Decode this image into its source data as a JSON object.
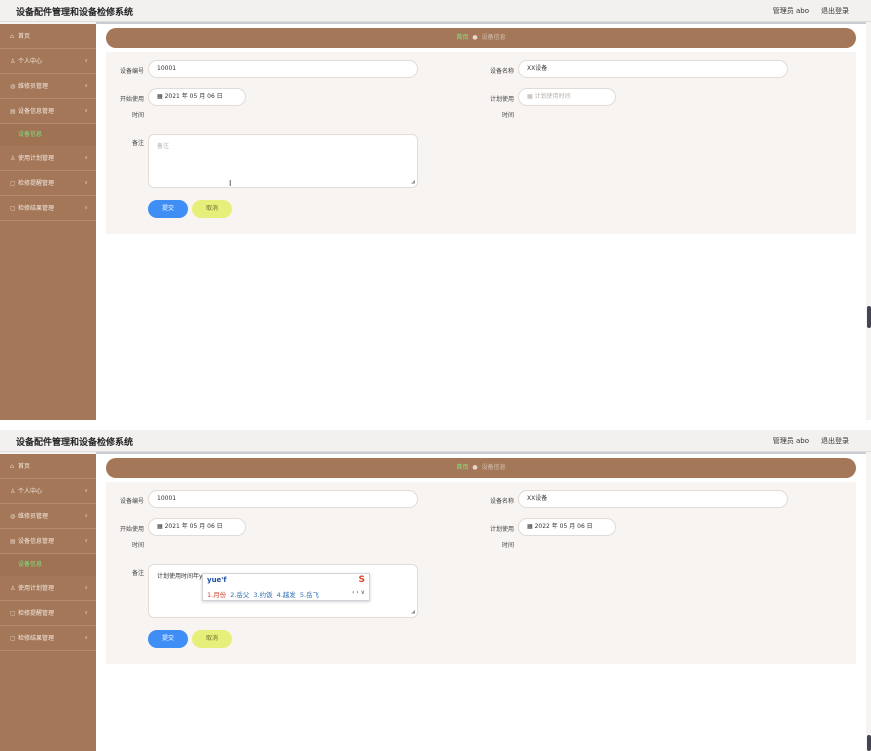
{
  "app": {
    "title": "设备配件管理和设备检修系统",
    "admin": "管理员 abo",
    "logout": "退出登录"
  },
  "sidebar": {
    "items": [
      {
        "icon": "⌂",
        "label": "首页"
      },
      {
        "icon": "♙",
        "label": "个人中心"
      },
      {
        "icon": "◍",
        "label": "维修员管理"
      },
      {
        "icon": "▤",
        "label": "设备信息管理"
      },
      {
        "icon": "",
        "label": "设备信息"
      },
      {
        "icon": "♙",
        "label": "使用计划管理"
      },
      {
        "icon": "▢",
        "label": "检修提醒管理"
      },
      {
        "icon": "▢",
        "label": "检修结果管理"
      }
    ]
  },
  "breadcrumb": {
    "home": "首页",
    "current": "设备信息"
  },
  "form": {
    "labels": {
      "device_no": "设备编号",
      "device_name": "设备名称",
      "start_use": "开始使用",
      "plan_use": "计划使用",
      "time_suffix": "时间",
      "remark": "备注"
    },
    "buttons": {
      "submit": "提交",
      "cancel": "取消"
    }
  },
  "panel1": {
    "device_no": "10001",
    "device_name": "XX设备",
    "start_date": "2021 年 05 月 06 日",
    "plan_date_placeholder": "计划使用时间",
    "remark_placeholder": "备注"
  },
  "panel2": {
    "device_no": "10001",
    "device_name": "XX设备",
    "start_date": "2021 年 05 月 06 日",
    "plan_date": "2022 年 05 月 06 日",
    "remark_text": "计划使用时间年yue|",
    "ime": {
      "pinyin": "yue'f",
      "logo": "S",
      "candidates": [
        "1.月份",
        "2.岳父",
        "3.约饭",
        "4.越发",
        "5.岳飞"
      ],
      "nav": "‹ › ∨"
    }
  },
  "icons": {
    "calendar": "▦",
    "chevron": "∨",
    "separator": "●",
    "ibeam": "I"
  }
}
